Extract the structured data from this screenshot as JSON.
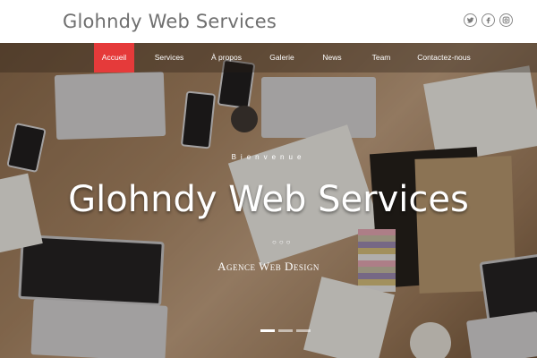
{
  "header": {
    "brand": "Glohndy Web Services",
    "social": [
      {
        "icon": "twitter-icon"
      },
      {
        "icon": "facebook-icon"
      },
      {
        "icon": "instagram-icon"
      }
    ]
  },
  "nav": {
    "items": [
      {
        "label": "Accueil",
        "active": true
      },
      {
        "label": "Services",
        "active": false
      },
      {
        "label": "À propos",
        "active": false
      },
      {
        "label": "Galerie",
        "active": false
      },
      {
        "label": "News",
        "active": false
      },
      {
        "label": "Team",
        "active": false
      },
      {
        "label": "Contactez-nous",
        "active": false
      }
    ]
  },
  "hero": {
    "welcome": "Bienvenue",
    "title": "Glohndy Web Services",
    "dots": "○○○",
    "subtitle": "Agence Web Design",
    "slides": {
      "count": 3,
      "active": 0
    }
  },
  "colors": {
    "accent": "#e53a3a",
    "brand_text": "#6f6f6f"
  }
}
